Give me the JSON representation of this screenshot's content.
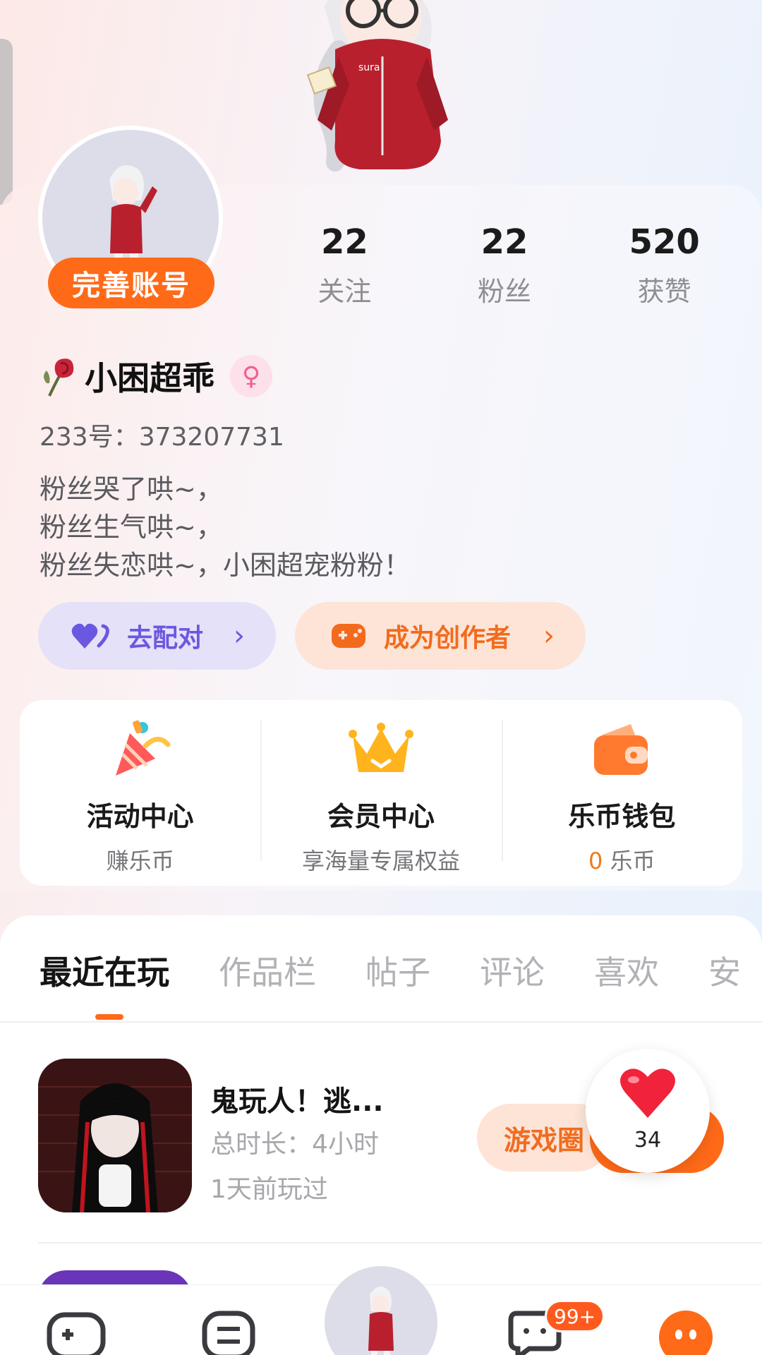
{
  "profile": {
    "complete_label": "完善账号",
    "name": "小困超乖",
    "uid": "233号：373207731",
    "bio": [
      "粉丝哭了哄~，",
      "粉丝生气哄~，",
      "粉丝失恋哄~，小困超宠粉粉！"
    ],
    "gender_symbol": "♀"
  },
  "stats": [
    {
      "num": "22",
      "label": "关注"
    },
    {
      "num": "22",
      "label": "粉丝"
    },
    {
      "num": "520",
      "label": "获赞"
    }
  ],
  "actions": {
    "match_label": "去配对",
    "creator_label": "成为创作者"
  },
  "services": [
    {
      "title": "活动中心",
      "sub": "赚乐币"
    },
    {
      "title": "会员中心",
      "sub": "享海量专属权益"
    },
    {
      "title": "乐币钱包",
      "sub_value": "0",
      "sub_unit": " 乐币"
    }
  ],
  "tabs": [
    "最近在玩",
    "作品栏",
    "帖子",
    "评论",
    "喜欢",
    "安"
  ],
  "recent_game": {
    "title": "鬼玩人！逃...",
    "duration": "总时长：4小时",
    "last_played": "1天前玩过",
    "circle_label": "游戏圈",
    "likes": "34"
  },
  "nav": {
    "message_badge": "99+"
  },
  "colors": {
    "accent": "#ff6a18",
    "match_purple": "#6b58e0",
    "gender_pink": "#f0608e"
  }
}
